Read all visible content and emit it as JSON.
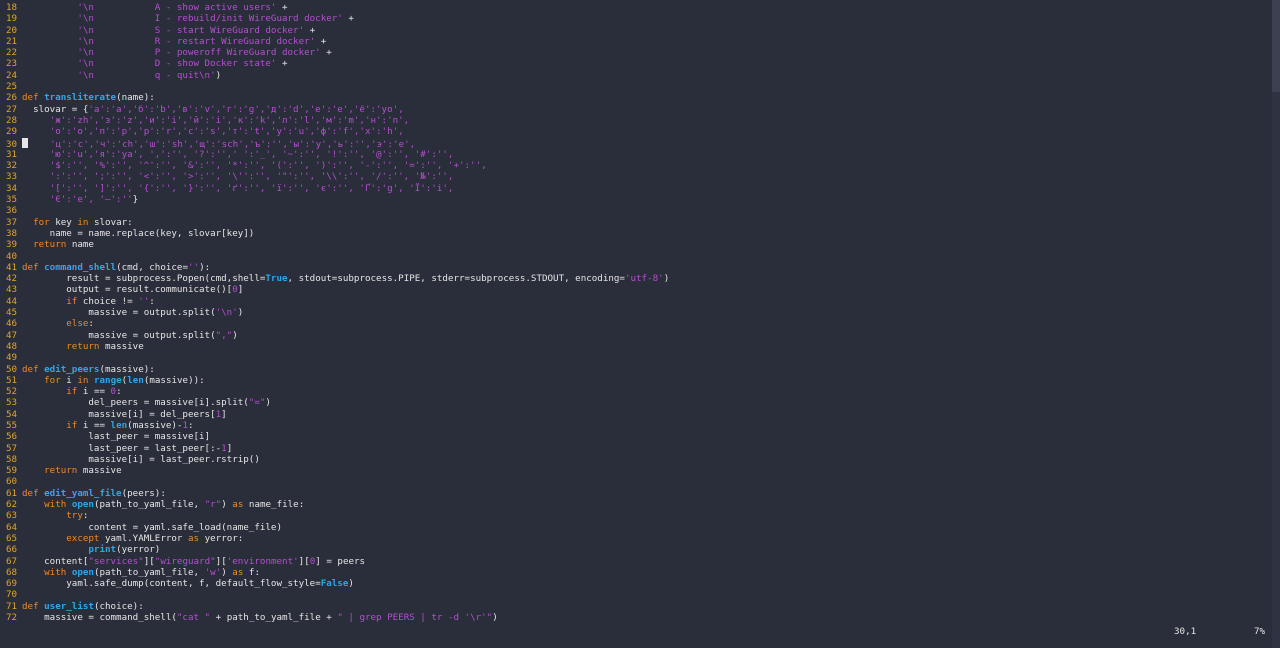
{
  "editor": {
    "lines": [
      {
        "n": "18",
        "segs": [
          [
            "p",
            "          "
          ],
          [
            "s",
            "'\\n           A - show active users'"
          ],
          [
            "p",
            " +"
          ]
        ]
      },
      {
        "n": "19",
        "segs": [
          [
            "p",
            "          "
          ],
          [
            "s",
            "'\\n           I - rebuild/init WireGuard docker'"
          ],
          [
            "p",
            " +"
          ]
        ]
      },
      {
        "n": "20",
        "segs": [
          [
            "p",
            "          "
          ],
          [
            "s",
            "'\\n           S - start WireGuard docker'"
          ],
          [
            "p",
            " +"
          ]
        ]
      },
      {
        "n": "21",
        "segs": [
          [
            "p",
            "          "
          ],
          [
            "s",
            "'\\n           R - restart WireGuard docker'"
          ],
          [
            "p",
            " +"
          ]
        ]
      },
      {
        "n": "22",
        "segs": [
          [
            "p",
            "          "
          ],
          [
            "s",
            "'\\n           P - poweroff WireGuard docker'"
          ],
          [
            "p",
            " +"
          ]
        ]
      },
      {
        "n": "23",
        "segs": [
          [
            "p",
            "          "
          ],
          [
            "s",
            "'\\n           D - show Docker state'"
          ],
          [
            "p",
            " +"
          ]
        ]
      },
      {
        "n": "24",
        "segs": [
          [
            "p",
            "          "
          ],
          [
            "s",
            "'\\n           q - quit\\n'"
          ],
          [
            "p",
            ")"
          ]
        ]
      },
      {
        "n": "25",
        "segs": []
      },
      {
        "n": "26",
        "segs": [
          [
            "k",
            "def "
          ],
          [
            "f",
            "transliterate"
          ],
          [
            "p",
            "(name):"
          ]
        ]
      },
      {
        "n": "27",
        "segs": [
          [
            "p",
            "  slovar = {"
          ],
          [
            "s",
            "'а':'a','б':'b','в':'v','г':'g','д':'d','е':'e','ё':'yo',"
          ]
        ]
      },
      {
        "n": "28",
        "segs": [
          [
            "p",
            "     "
          ],
          [
            "s",
            "'ж':'zh','з':'z','и':'i','й':'i','к':'k','л':'l','м':'m','н':'n',"
          ]
        ]
      },
      {
        "n": "29",
        "segs": [
          [
            "p",
            "     "
          ],
          [
            "s",
            "'о':'o','п':'p','р':'r','с':'s','т':'t','у':'u','ф':'f','х':'h',"
          ]
        ]
      },
      {
        "n": "30",
        "segs": [
          [
            "c",
            ""
          ],
          [
            "p",
            "    "
          ],
          [
            "s",
            "'ц':'c','ч':'ch','ш':'sh','щ':'sch','ъ':'','ы':'y','ь':'','э':'e',"
          ]
        ]
      },
      {
        "n": "31",
        "segs": [
          [
            "p",
            "     "
          ],
          [
            "s",
            "'ю':'u','я':'ya', ',':'', '?':'',' ':'_', '~':'', '!':'', '@':'', '#':'',"
          ]
        ]
      },
      {
        "n": "32",
        "segs": [
          [
            "p",
            "     "
          ],
          [
            "s",
            "'$':'', '%':'', '^':'', '&':'', '*':'', '(':'', ')':'', '-':'', '=':'', '+':'',"
          ]
        ]
      },
      {
        "n": "33",
        "segs": [
          [
            "p",
            "     "
          ],
          [
            "s",
            "':':'', ';':'', '<':'', '>':'', '\\'':'', '\"':'', '\\\\':'', '/':'', '№':'',"
          ]
        ]
      },
      {
        "n": "34",
        "segs": [
          [
            "p",
            "     "
          ],
          [
            "s",
            "'[':'', ']':'', '{':'', '}':'', 'ґ':'', 'ї':'', 'є':'', 'Ґ':'g', 'Ї':'i',"
          ]
        ]
      },
      {
        "n": "35",
        "segs": [
          [
            "p",
            "     "
          ],
          [
            "s",
            "'Є':'e', '—':''"
          ],
          [
            "p",
            "}"
          ]
        ]
      },
      {
        "n": "36",
        "segs": []
      },
      {
        "n": "37",
        "segs": [
          [
            "p",
            "  "
          ],
          [
            "k",
            "for"
          ],
          [
            "p",
            " key "
          ],
          [
            "k",
            "in"
          ],
          [
            "p",
            " slovar:"
          ]
        ]
      },
      {
        "n": "38",
        "segs": [
          [
            "p",
            "     name = name.replace(key, slovar[key])"
          ]
        ]
      },
      {
        "n": "39",
        "segs": [
          [
            "p",
            "  "
          ],
          [
            "k",
            "return"
          ],
          [
            "p",
            " name"
          ]
        ]
      },
      {
        "n": "40",
        "segs": []
      },
      {
        "n": "41",
        "segs": [
          [
            "k",
            "def "
          ],
          [
            "f",
            "command_shell"
          ],
          [
            "p",
            "(cmd, choice="
          ],
          [
            "s",
            "''"
          ],
          [
            "p",
            "):"
          ]
        ]
      },
      {
        "n": "42",
        "segs": [
          [
            "p",
            "        result = subprocess.Popen(cmd,shell="
          ],
          [
            "b",
            "True"
          ],
          [
            "p",
            ", stdout=subprocess.PIPE, stderr=subprocess.STDOUT, encoding="
          ],
          [
            "s",
            "'utf-8'"
          ],
          [
            "p",
            ")"
          ]
        ]
      },
      {
        "n": "43",
        "segs": [
          [
            "p",
            "        output = result.communicate()["
          ],
          [
            "n",
            "0"
          ],
          [
            "p",
            "]"
          ]
        ]
      },
      {
        "n": "44",
        "segs": [
          [
            "p",
            "        "
          ],
          [
            "k",
            "if"
          ],
          [
            "p",
            " choice != "
          ],
          [
            "s",
            "''"
          ],
          [
            "p",
            ":"
          ]
        ]
      },
      {
        "n": "45",
        "segs": [
          [
            "p",
            "            massive = output.split("
          ],
          [
            "s",
            "'\\n'"
          ],
          [
            "p",
            ")"
          ]
        ]
      },
      {
        "n": "46",
        "segs": [
          [
            "p",
            "        "
          ],
          [
            "k",
            "else"
          ],
          [
            "p",
            ":"
          ]
        ]
      },
      {
        "n": "47",
        "segs": [
          [
            "p",
            "            massive = output.split("
          ],
          [
            "s",
            "\",\""
          ],
          [
            "p",
            ")"
          ]
        ]
      },
      {
        "n": "48",
        "segs": [
          [
            "p",
            "        "
          ],
          [
            "k",
            "return"
          ],
          [
            "p",
            " massive"
          ]
        ]
      },
      {
        "n": "49",
        "segs": []
      },
      {
        "n": "50",
        "segs": [
          [
            "k",
            "def "
          ],
          [
            "f",
            "edit_peers"
          ],
          [
            "p",
            "(massive):"
          ]
        ]
      },
      {
        "n": "51",
        "segs": [
          [
            "p",
            "    "
          ],
          [
            "k",
            "for"
          ],
          [
            "p",
            " i "
          ],
          [
            "k",
            "in"
          ],
          [
            "p",
            " "
          ],
          [
            "b",
            "range"
          ],
          [
            "p",
            "("
          ],
          [
            "b",
            "len"
          ],
          [
            "p",
            "(massive)):"
          ]
        ]
      },
      {
        "n": "52",
        "segs": [
          [
            "p",
            "        "
          ],
          [
            "k",
            "if"
          ],
          [
            "p",
            " i == "
          ],
          [
            "n",
            "0"
          ],
          [
            "p",
            ":"
          ]
        ]
      },
      {
        "n": "53",
        "segs": [
          [
            "p",
            "            del_peers = massive[i].split("
          ],
          [
            "s",
            "\"=\""
          ],
          [
            "p",
            ")"
          ]
        ]
      },
      {
        "n": "54",
        "segs": [
          [
            "p",
            "            massive[i] = del_peers["
          ],
          [
            "n",
            "1"
          ],
          [
            "p",
            "]"
          ]
        ]
      },
      {
        "n": "55",
        "segs": [
          [
            "p",
            "        "
          ],
          [
            "k",
            "if"
          ],
          [
            "p",
            " i == "
          ],
          [
            "b",
            "len"
          ],
          [
            "p",
            "(massive)-"
          ],
          [
            "n",
            "1"
          ],
          [
            "p",
            ":"
          ]
        ]
      },
      {
        "n": "56",
        "segs": [
          [
            "p",
            "            last_peer = massive[i]"
          ]
        ]
      },
      {
        "n": "57",
        "segs": [
          [
            "p",
            "            last_peer = last_peer[:-"
          ],
          [
            "n",
            "1"
          ],
          [
            "p",
            "]"
          ]
        ]
      },
      {
        "n": "58",
        "segs": [
          [
            "p",
            "            massive[i] = last_peer.rstrip()"
          ]
        ]
      },
      {
        "n": "59",
        "segs": [
          [
            "p",
            "    "
          ],
          [
            "k",
            "return"
          ],
          [
            "p",
            " massive"
          ]
        ]
      },
      {
        "n": "60",
        "segs": []
      },
      {
        "n": "61",
        "segs": [
          [
            "k",
            "def "
          ],
          [
            "f",
            "edit_yaml_file"
          ],
          [
            "p",
            "(peers):"
          ]
        ]
      },
      {
        "n": "62",
        "segs": [
          [
            "p",
            "    "
          ],
          [
            "k",
            "with"
          ],
          [
            "p",
            " "
          ],
          [
            "b",
            "open"
          ],
          [
            "p",
            "(path_to_yaml_file, "
          ],
          [
            "s",
            "\"r\""
          ],
          [
            "p",
            ") "
          ],
          [
            "k",
            "as"
          ],
          [
            "p",
            " name_file:"
          ]
        ]
      },
      {
        "n": "63",
        "segs": [
          [
            "p",
            "        "
          ],
          [
            "k",
            "try"
          ],
          [
            "p",
            ":"
          ]
        ]
      },
      {
        "n": "64",
        "segs": [
          [
            "p",
            "            content = yaml.safe_load(name_file)"
          ]
        ]
      },
      {
        "n": "65",
        "segs": [
          [
            "p",
            "        "
          ],
          [
            "k",
            "except"
          ],
          [
            "p",
            " yaml.YAMLError "
          ],
          [
            "k",
            "as"
          ],
          [
            "p",
            " yerror:"
          ]
        ]
      },
      {
        "n": "66",
        "segs": [
          [
            "p",
            "            "
          ],
          [
            "b",
            "print"
          ],
          [
            "p",
            "(yerror)"
          ]
        ]
      },
      {
        "n": "67",
        "segs": [
          [
            "p",
            "    content["
          ],
          [
            "s",
            "\"services\""
          ],
          [
            "p",
            "]["
          ],
          [
            "s",
            "\"wireguard\""
          ],
          [
            "p",
            "]["
          ],
          [
            "s",
            "'environment'"
          ],
          [
            "p",
            "]["
          ],
          [
            "n",
            "0"
          ],
          [
            "p",
            "] = peers"
          ]
        ]
      },
      {
        "n": "68",
        "segs": [
          [
            "p",
            "    "
          ],
          [
            "k",
            "with"
          ],
          [
            "p",
            " "
          ],
          [
            "b",
            "open"
          ],
          [
            "p",
            "(path_to_yaml_file, "
          ],
          [
            "s",
            "'w'"
          ],
          [
            "p",
            ") "
          ],
          [
            "k",
            "as"
          ],
          [
            "p",
            " f:"
          ]
        ]
      },
      {
        "n": "69",
        "segs": [
          [
            "p",
            "        yaml.safe_dump(content, f, default_flow_style="
          ],
          [
            "b",
            "False"
          ],
          [
            "p",
            ")"
          ]
        ]
      },
      {
        "n": "70",
        "segs": []
      },
      {
        "n": "71",
        "segs": [
          [
            "k",
            "def "
          ],
          [
            "f",
            "user_list"
          ],
          [
            "p",
            "(choice):"
          ]
        ]
      },
      {
        "n": "72",
        "segs": [
          [
            "p",
            "    massive = command_shell("
          ],
          [
            "s",
            "\"cat \""
          ],
          [
            "p",
            " + path_to_yaml_file + "
          ],
          [
            "s",
            "\" | grep PEERS | tr -d '\\r'\""
          ],
          [
            "p",
            ")"
          ]
        ]
      }
    ]
  },
  "statusbar": {
    "cursor_position": "30,1",
    "scroll_percent": "7%"
  }
}
